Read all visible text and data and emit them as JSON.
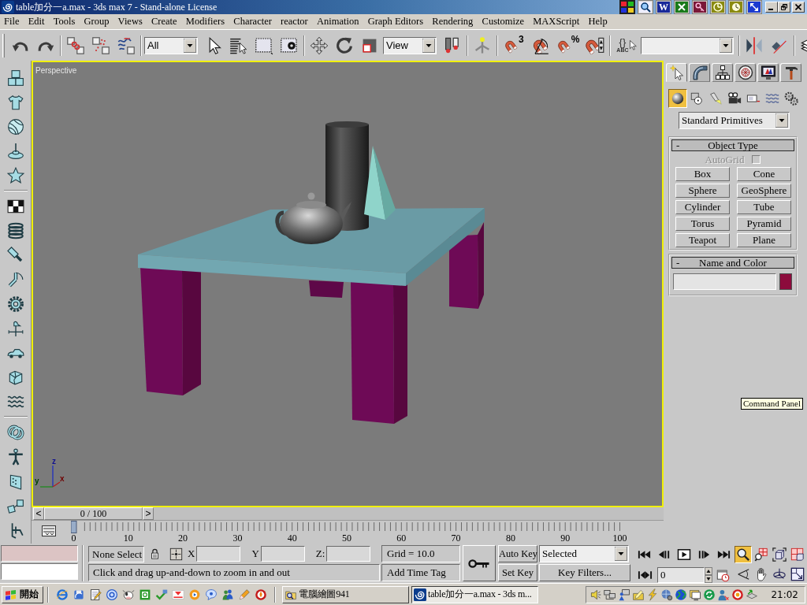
{
  "title_bar": {
    "title": "table加分一a.max - 3ds max 7 - Stand-alone License",
    "shortcut_letter": "W"
  },
  "menu": [
    "File",
    "Edit",
    "Tools",
    "Group",
    "Views",
    "Create",
    "Modifiers",
    "Character",
    "reactor",
    "Animation",
    "Graph Editors",
    "Rendering",
    "Customize",
    "MAXScript",
    "Help"
  ],
  "main_toolbar": {
    "selection_filter": "All",
    "reference_coordinate": "View",
    "snap_dimension": "3",
    "percent_sign": "%",
    "named_set_braces": "{}",
    "named_set_caption": "ABC"
  },
  "viewport": {
    "label": "Perspective",
    "axis_labels": [
      "z",
      "y",
      "x"
    ]
  },
  "command_panel": {
    "tabs": [
      {
        "selected": true
      },
      {
        "selected": false
      },
      {
        "selected": false
      },
      {
        "selected": false
      },
      {
        "selected": false
      },
      {
        "selected": false
      }
    ],
    "categories": [
      {
        "selected": true
      },
      {
        "selected": false
      },
      {
        "selected": false
      },
      {
        "selected": false
      },
      {
        "selected": false
      },
      {
        "selected": false
      },
      {
        "selected": false
      }
    ],
    "object_category": "Standard Primitives",
    "object_type": {
      "collapse_sign": "-",
      "title": "Object Type",
      "autogrid": {
        "label": "AutoGrid",
        "checked": false,
        "disabled": true
      },
      "buttons": [
        "Box",
        "Cone",
        "Sphere",
        "GeoSphere",
        "Cylinder",
        "Tube",
        "Torus",
        "Pyramid",
        "Teapot",
        "Plane"
      ]
    },
    "name_and_color": {
      "collapse_sign": "-",
      "title": "Name and Color",
      "color": "#8c0b3c"
    },
    "tooltip": "Command Panel"
  },
  "time_slider": {
    "prev": "<",
    "position": "0 / 100",
    "next": ">",
    "level": 0
  },
  "track_bar": {
    "frame_labels": [
      "0",
      "10",
      "20",
      "30",
      "40",
      "50",
      "60",
      "70",
      "80",
      "90",
      "100"
    ]
  },
  "status": {
    "selection": "None Select",
    "coord_labels": [
      "X",
      "Y",
      "Z:"
    ],
    "grid": "Grid = 10.0",
    "prompt": "Click and drag up-and-down to zoom in and out",
    "time_tag": "Add Time Tag"
  },
  "animation": {
    "auto_key": {
      "label": "Auto Key",
      "on": false
    },
    "key_set": "Selected",
    "set_key": "Set Key",
    "key_filters": "Key Filters...",
    "current_frame": "0"
  },
  "viewport_nav": [
    {
      "selected": true
    },
    {
      "selected": false
    },
    {
      "selected": false
    },
    {
      "selected": false
    },
    {
      "selected": false
    },
    {
      "selected": false
    },
    {
      "selected": false
    },
    {
      "selected": false
    }
  ],
  "taskbar": {
    "start": "開始",
    "windows": [
      {
        "title": "電腦繪圖941",
        "selected": false
      },
      {
        "title": "table加分一a.max - 3ds m...",
        "selected": true
      }
    ],
    "clock": "21:02"
  }
}
